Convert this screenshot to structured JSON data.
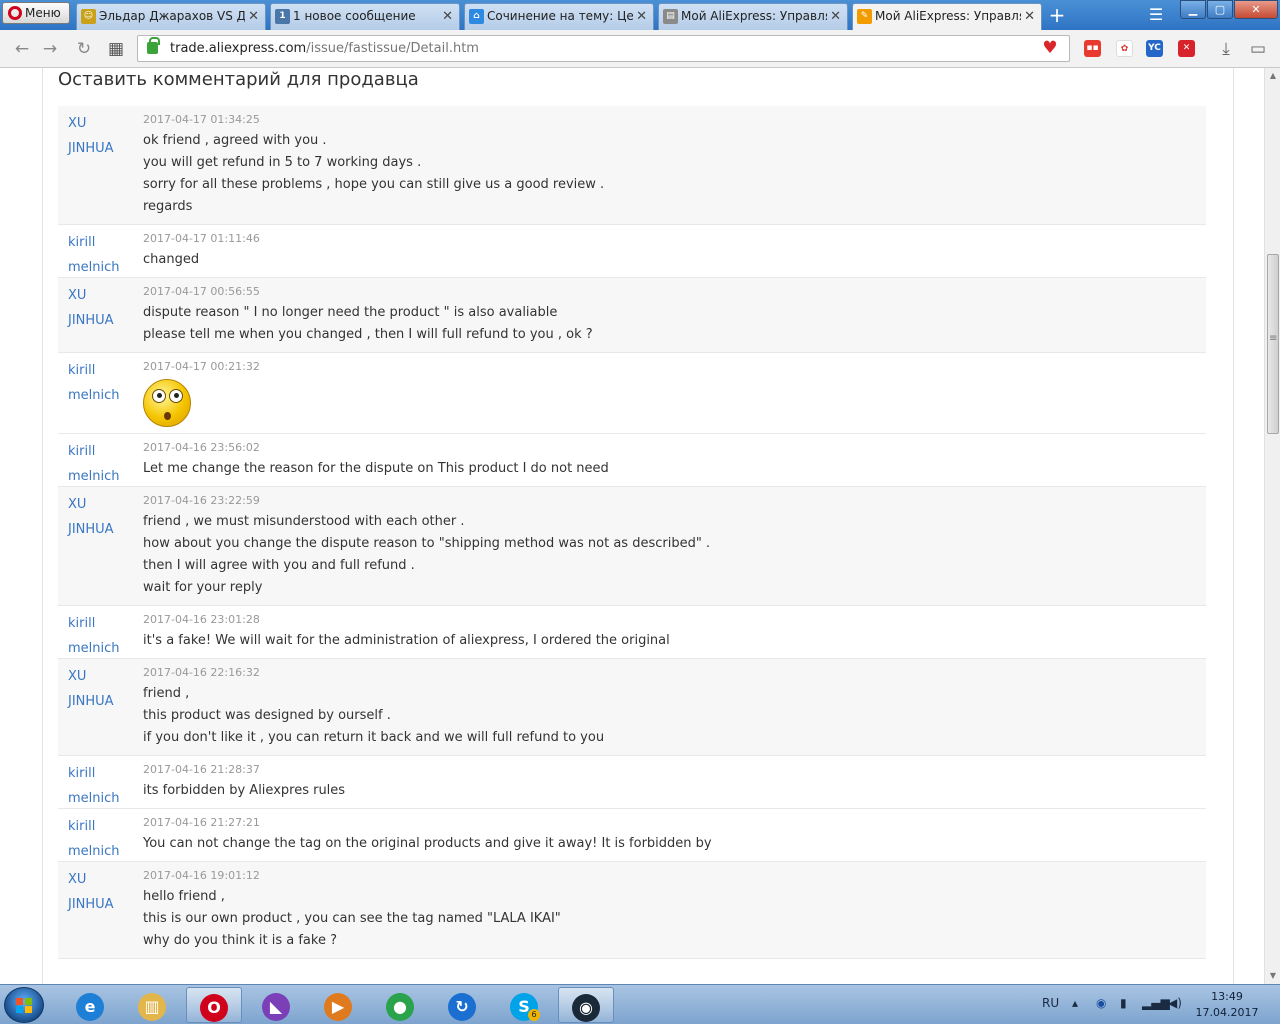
{
  "browser": {
    "menu_label": "Меню",
    "tabs": [
      {
        "title": "Эльдар Джарахов VS Дми",
        "fav_color": "#c9a21a",
        "fav_glyph": "☺"
      },
      {
        "title": "1 новое сообщение",
        "fav_color": "#4a76a8",
        "fav_glyph": "1"
      },
      {
        "title": "Сочинение на тему: Ценн",
        "fav_color": "#2d8ae0",
        "fav_glyph": "⌂"
      },
      {
        "title": "Мой AliExpress: Управлять",
        "fav_color": "#8a8a8a",
        "fav_glyph": "▤"
      },
      {
        "title": "Мой AliExpress: Управлять",
        "fav_color": "#f29c00",
        "fav_glyph": "✎"
      }
    ],
    "active_tab": 4,
    "url_domain": "trade.aliexpress.com",
    "url_path": "/issue/fastissue/Detail.htm",
    "accent": "#2f74c4"
  },
  "page": {
    "section_title": "Оставить комментарий для продавца",
    "messages": [
      {
        "author": [
          "XU",
          "JINHUA"
        ],
        "time": "2017-04-17 01:34:25",
        "lines": [
          "ok friend , agreed with you .",
          "you will get refund in 5 to 7 working days .",
          "sorry for all these problems , hope you can still give us a good review .",
          "regards"
        ]
      },
      {
        "author": [
          "kirill",
          "melnich"
        ],
        "time": "2017-04-17 01:11:46",
        "lines": [
          "changed"
        ]
      },
      {
        "author": [
          "XU",
          "JINHUA"
        ],
        "time": "2017-04-17 00:56:55",
        "lines": [
          "dispute reason \" I no longer need the product \" is also avaliable",
          "please tell me when you changed , then I will full refund to you , ok ?"
        ]
      },
      {
        "author": [
          "kirill",
          "melnich"
        ],
        "time": "2017-04-17 00:21:32",
        "lines": [],
        "emoji": "surprised-smiley"
      },
      {
        "author": [
          "kirill",
          "melnich"
        ],
        "time": "2017-04-16 23:56:02",
        "lines": [
          "Let me change the reason for the dispute on This product I do not need"
        ]
      },
      {
        "author": [
          "XU",
          "JINHUA"
        ],
        "time": "2017-04-16 23:22:59",
        "lines": [
          "friend , we must misunderstood with each other .",
          "how about you change the dispute reason to \"shipping method was not as described\" .",
          "then I will agree with you and full refund .",
          "wait for your reply"
        ]
      },
      {
        "author": [
          "kirill",
          "melnich"
        ],
        "time": "2017-04-16 23:01:28",
        "lines": [
          "it's a fake! We will wait for the administration of aliexpress, I ordered the original"
        ]
      },
      {
        "author": [
          "XU",
          "JINHUA"
        ],
        "time": "2017-04-16 22:16:32",
        "lines": [
          "friend ,",
          "this product was designed by ourself .",
          "if you don't like it , you can return it back and we will full refund to you"
        ]
      },
      {
        "author": [
          "kirill",
          "melnich"
        ],
        "time": "2017-04-16 21:28:37",
        "lines": [
          "its forbidden by Aliexpres rules"
        ]
      },
      {
        "author": [
          "kirill",
          "melnich"
        ],
        "time": "2017-04-16 21:27:21",
        "lines": [
          "You can not change the tag on the original products and give it away! It is forbidden by"
        ]
      },
      {
        "author": [
          "XU",
          "JINHUA"
        ],
        "time": "2017-04-16 19:01:12",
        "lines": [
          "hello friend ,",
          "this is our own product , you can see the tag named \"LALA IKAI\"",
          "why do you think it is a fake ?"
        ]
      }
    ]
  },
  "taskbar": {
    "apps": [
      {
        "name": "internet-explorer",
        "glyph": "e",
        "color": "#1e7fd6"
      },
      {
        "name": "file-explorer",
        "glyph": "▥",
        "color": "#e2b64a"
      },
      {
        "name": "opera",
        "glyph": "O",
        "color": "#d0021b",
        "active": true
      },
      {
        "name": "visual-studio",
        "glyph": "◣",
        "color": "#7b3fb8"
      },
      {
        "name": "media-player",
        "glyph": "▶",
        "color": "#e07a1f"
      },
      {
        "name": "chrome",
        "glyph": "●",
        "color": "#2aa34a"
      },
      {
        "name": "update-client",
        "glyph": "↻",
        "color": "#1a6fd0"
      },
      {
        "name": "skype",
        "glyph": "S",
        "color": "#00a2e8",
        "badge": "6"
      },
      {
        "name": "steam",
        "glyph": "◉",
        "color": "#1b2838",
        "active": true
      }
    ],
    "language": "RU",
    "time": "13:49",
    "date": "17.04.2017"
  }
}
